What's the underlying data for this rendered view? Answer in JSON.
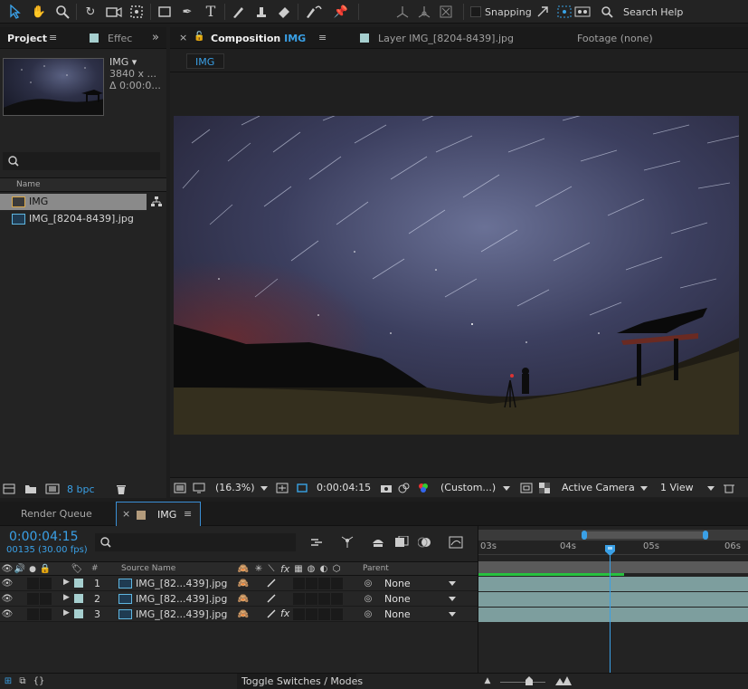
{
  "toolbar": {
    "snapping_label": "Snapping",
    "search_help_label": "Search Help"
  },
  "project_panel": {
    "tab_label": "Project",
    "effects_tab_label": "Effec",
    "selected_item": {
      "name": "IMG ▾",
      "resolution": "3840 x ...",
      "duration": "Δ 0:00:0..."
    },
    "name_column": "Name",
    "items": [
      {
        "name": "IMG",
        "type": "composition",
        "selected": true
      },
      {
        "name": "IMG_[8204-8439].jpg",
        "type": "footage",
        "selected": false
      }
    ],
    "bpc_label": "8 bpc"
  },
  "comp_panel": {
    "tabs": [
      {
        "prefix": "Composition",
        "name": "IMG",
        "active": true
      },
      {
        "prefix": "Layer",
        "name": "IMG_[8204-8439].jpg",
        "active": false
      },
      {
        "prefix": "Footage",
        "name": "(none)",
        "active": false
      }
    ],
    "breadcrumb": "IMG",
    "zoom_label": "(16.3%)",
    "current_time": "0:00:04:15",
    "resolution_label": "(Custom...)",
    "camera_label": "Active Camera",
    "view_label": "1 View"
  },
  "timeline": {
    "render_queue_tab": "Render Queue",
    "comp_tab": "IMG",
    "timecode": "0:00:04:15",
    "frame_info": "00135 (30.00 fps)",
    "columns": {
      "number": "#",
      "source_name": "Source Name",
      "parent": "Parent"
    },
    "layers": [
      {
        "number": "1",
        "name": "IMG_[82...439].jpg",
        "parent": "None",
        "fx": false
      },
      {
        "number": "2",
        "name": "IMG_[82...439].jpg",
        "parent": "None",
        "fx": false
      },
      {
        "number": "3",
        "name": "IMG_[82...439].jpg",
        "parent": "None",
        "fx": true
      }
    ],
    "ruler_ticks": [
      "03s",
      "04s",
      "05s",
      "06s"
    ],
    "toggle_label": "Toggle Switches / Modes"
  },
  "colors": {
    "accent_blue": "#2d9fe0",
    "layer_label": "#a6cfcf",
    "track": "#7d9e9e",
    "work_area_green": "#27c140"
  }
}
